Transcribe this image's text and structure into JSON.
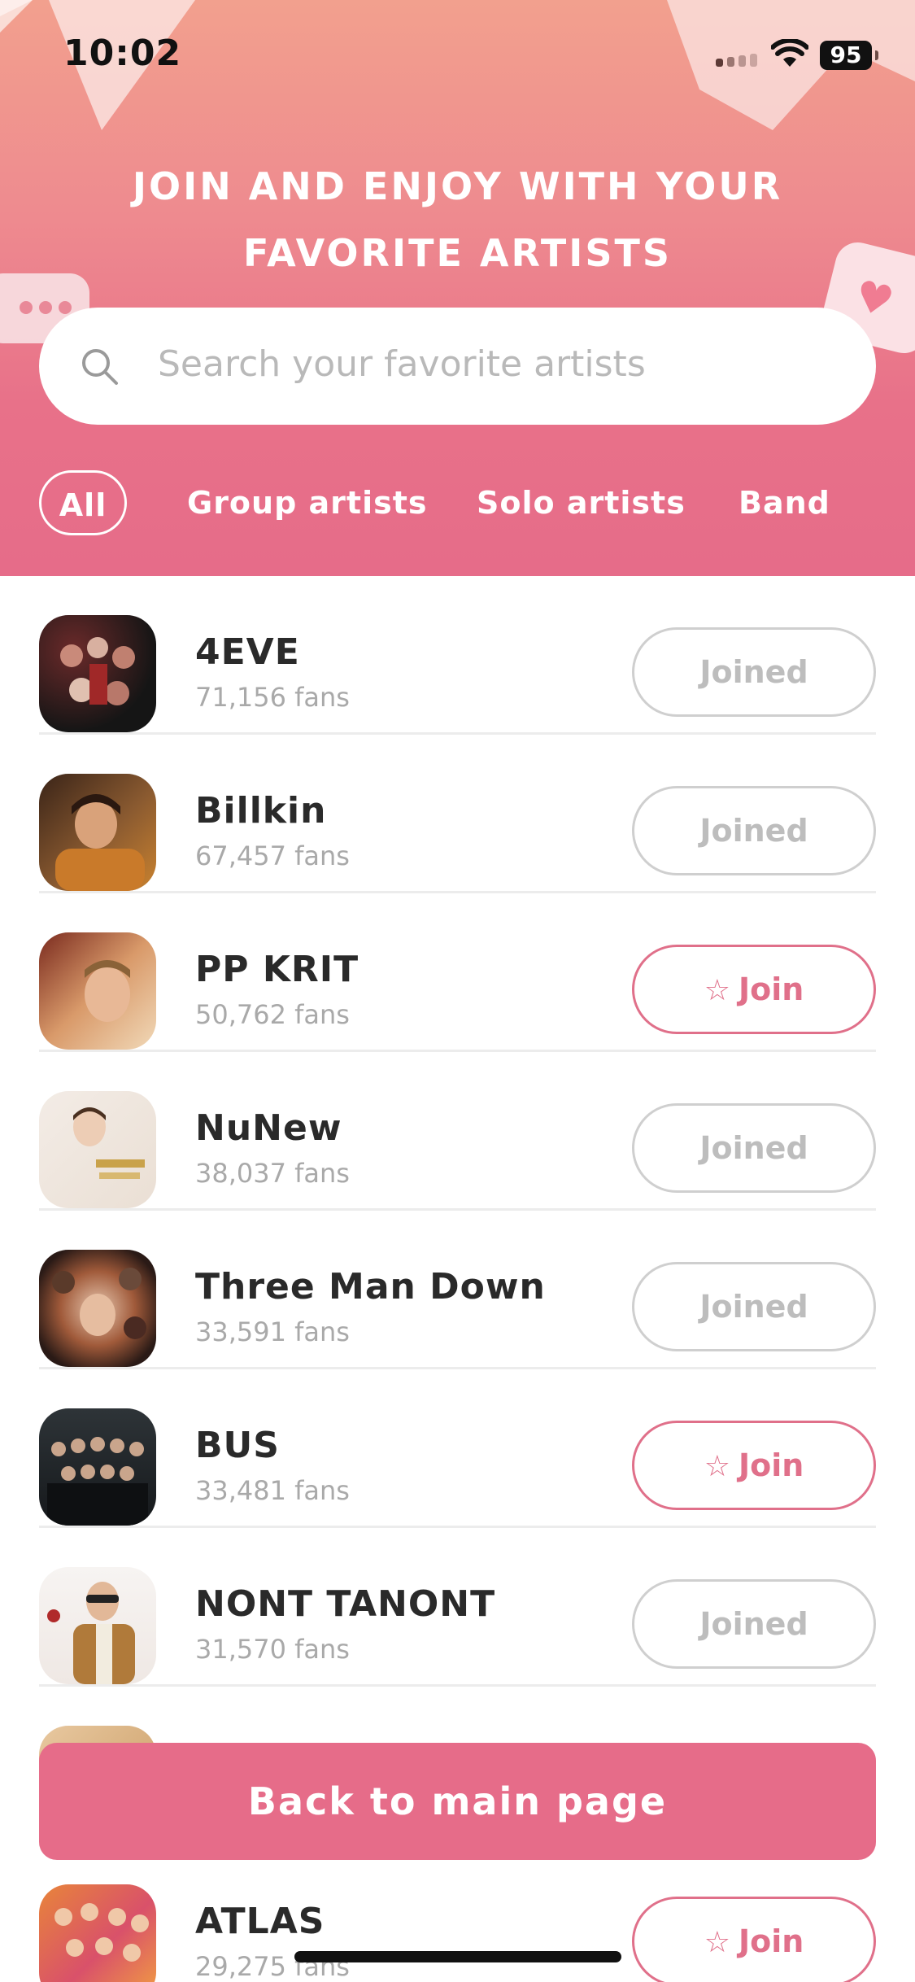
{
  "status_bar": {
    "time": "10:02",
    "battery": "95"
  },
  "header": {
    "line1": "JOIN AND ENJOY WITH YOUR",
    "line2": "FAVORITE ARTISTS"
  },
  "search": {
    "placeholder": "Search your favorite artists"
  },
  "tabs": [
    {
      "label": "All",
      "active": true
    },
    {
      "label": "Group artists",
      "active": false
    },
    {
      "label": "Solo artists",
      "active": false
    },
    {
      "label": "Band",
      "active": false
    }
  ],
  "artists": [
    {
      "name": "4EVE",
      "fans": "71,156 fans",
      "button": "Joined",
      "state": "joined"
    },
    {
      "name": "Billkin",
      "fans": "67,457 fans",
      "button": "Joined",
      "state": "joined"
    },
    {
      "name": "PP KRIT",
      "fans": "50,762 fans",
      "button": "Join",
      "state": "join"
    },
    {
      "name": "NuNew",
      "fans": "38,037 fans",
      "button": "Joined",
      "state": "joined"
    },
    {
      "name": "Three Man Down",
      "fans": "33,591 fans",
      "button": "Joined",
      "state": "joined"
    },
    {
      "name": "BUS",
      "fans": "33,481 fans",
      "button": "Join",
      "state": "join"
    },
    {
      "name": "NONT TANONT",
      "fans": "31,570 fans",
      "button": "Joined",
      "state": "joined"
    },
    {
      "name": "ATLAS",
      "fans": "29,275 fans",
      "button": "Join",
      "state": "join"
    }
  ],
  "back_button": {
    "label": "Back to main page"
  },
  "colors": {
    "accent": "#e66c89",
    "header_top": "#f2a08e",
    "joined_border": "#cfcfcf"
  }
}
